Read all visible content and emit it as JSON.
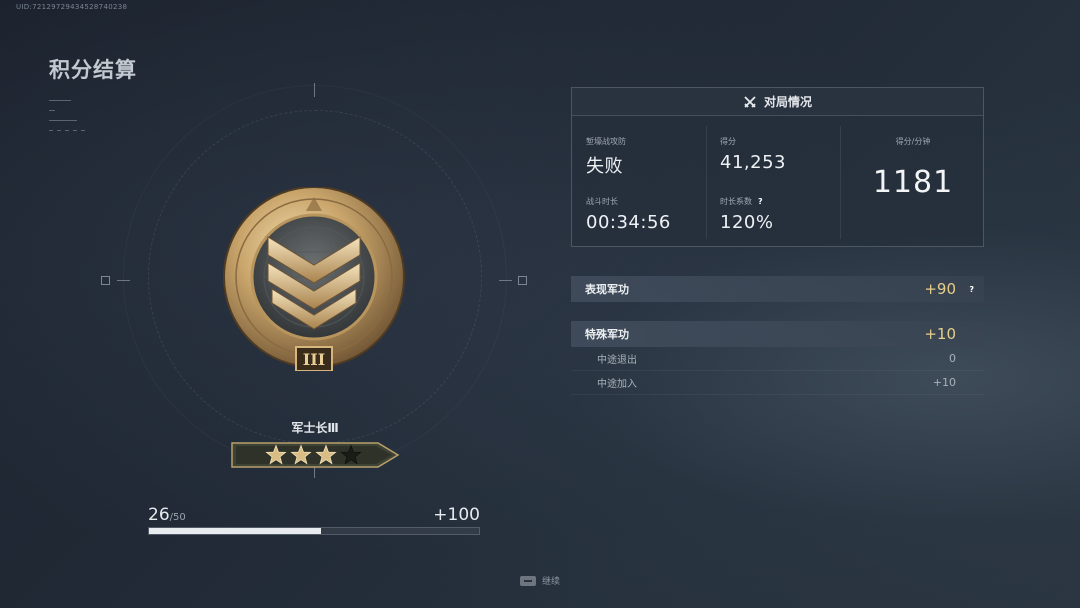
{
  "uid": "UID:72129729434528740238",
  "page_title": "积分结算",
  "rank": {
    "name": "军士长Ⅲ",
    "medal_numeral": "III",
    "stars_total": 4,
    "stars_filled": 3,
    "progress_current": "26",
    "progress_max": "/50",
    "progress_fraction": 0.52,
    "progress_gain": "+100"
  },
  "stats": {
    "header": "对局情况",
    "mode_label": "堑壕战攻防",
    "mode_value": "失败",
    "score_label": "得分",
    "score_value": "41,253",
    "spm_label": "得分/分钟",
    "spm_value": "1181",
    "time_label": "战斗时长",
    "time_value": "00:34:56",
    "coef_label": "时长系数",
    "coef_help": "?",
    "coef_value": "120%"
  },
  "merits": {
    "performance": {
      "label": "表现军功",
      "value": "+90",
      "help": "?"
    },
    "special": {
      "label": "特殊军功",
      "value": "+10"
    },
    "special_items": [
      {
        "label": "中途退出",
        "value": "0"
      },
      {
        "label": "中途加入",
        "value": "+10"
      }
    ]
  },
  "footer": {
    "continue_label": "继续"
  },
  "colors": {
    "gold": "#e7cf8a",
    "background": "#212a36",
    "medal_bronze": "#c9a56b"
  }
}
